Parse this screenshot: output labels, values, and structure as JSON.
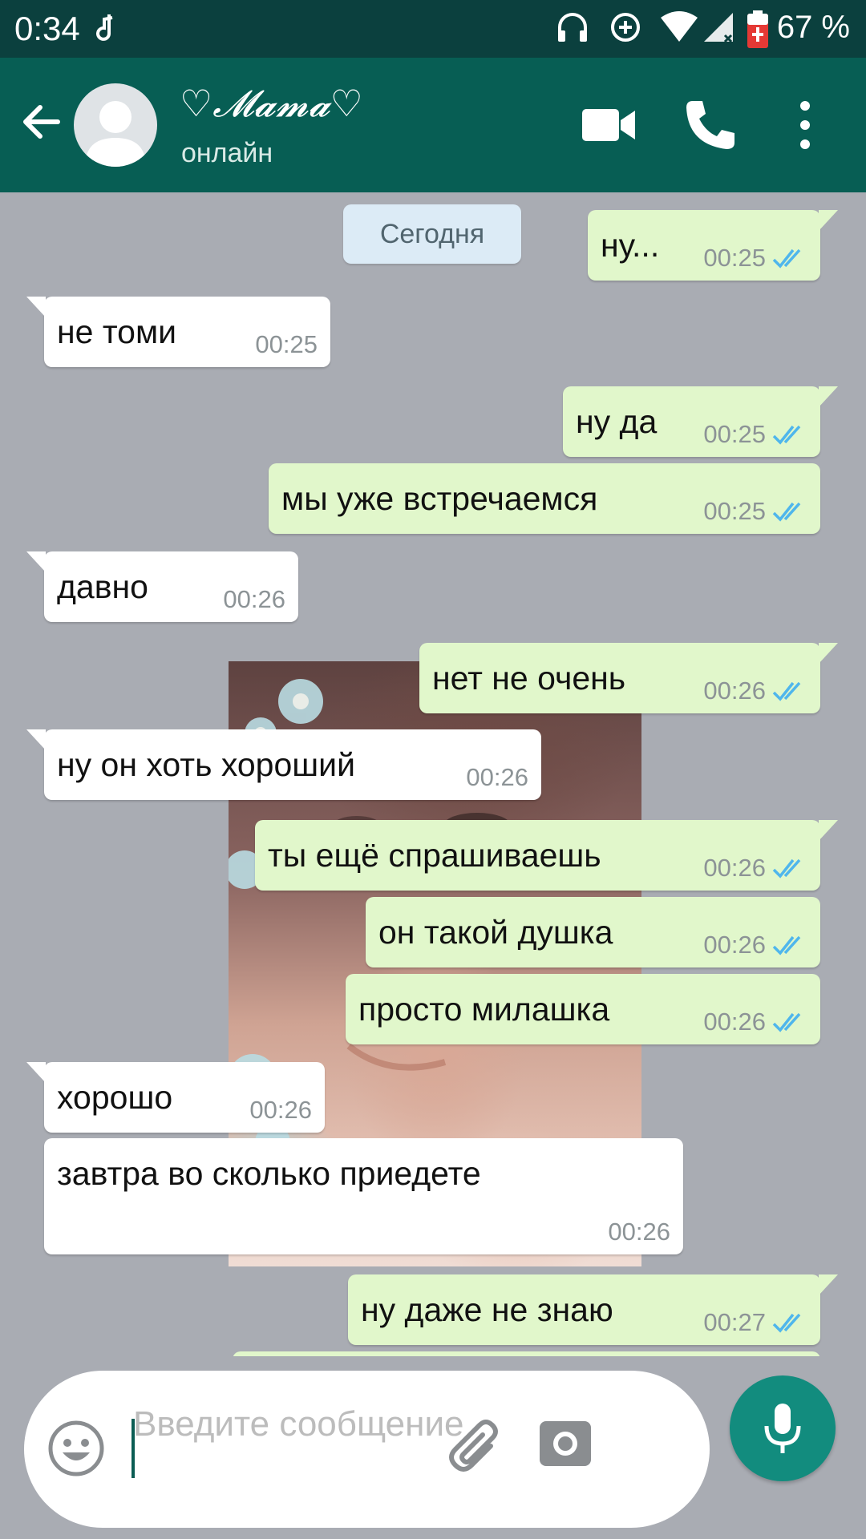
{
  "status_bar": {
    "time": "0:34",
    "battery_percent": "67 %",
    "icons": [
      "music-note-icon",
      "headphones-icon",
      "data-saver-icon",
      "wifi-icon",
      "signal-icon",
      "battery-icon"
    ]
  },
  "header": {
    "contact_name": "♡𝓜𝓪𝓶𝓪♡",
    "contact_status": "онлайн",
    "icons": [
      "back-arrow-icon",
      "avatar-placeholder-icon",
      "video-call-icon",
      "phone-call-icon",
      "more-vert-icon"
    ]
  },
  "chat": {
    "date_chip": "Сегодня",
    "messages": [
      {
        "dir": "out",
        "text": "ну...",
        "time": "00:25",
        "read": true
      },
      {
        "dir": "in",
        "text": "не томи",
        "time": "00:25"
      },
      {
        "dir": "out",
        "text": "ну да",
        "time": "00:25",
        "read": true
      },
      {
        "dir": "out",
        "text": "мы уже встречаемся",
        "time": "00:25",
        "read": true
      },
      {
        "dir": "in",
        "text": "давно",
        "time": "00:26"
      },
      {
        "dir": "out",
        "text": "нет не очень",
        "time": "00:26",
        "read": true
      },
      {
        "dir": "in",
        "text": "ну он хоть хороший",
        "time": "00:26"
      },
      {
        "dir": "out",
        "text": "ты ещё спрашиваешь",
        "time": "00:26",
        "read": true
      },
      {
        "dir": "out",
        "text": "он такой душка",
        "time": "00:26",
        "read": true
      },
      {
        "dir": "out",
        "text": "просто милашка",
        "time": "00:26",
        "read": true
      },
      {
        "dir": "in",
        "text": "хорошо",
        "time": "00:26"
      },
      {
        "dir": "in",
        "text": "завтра во сколько приедете",
        "time": "00:26"
      },
      {
        "dir": "out",
        "text": "ну даже не знаю",
        "time": "00:27",
        "read": true
      }
    ]
  },
  "composer": {
    "placeholder": "Введите сообщение",
    "icons": [
      "emoji-icon",
      "paperclip-icon",
      "camera-icon",
      "microphone-icon"
    ]
  },
  "colors": {
    "status_bar": "#0b403e",
    "app_bar": "#075e54",
    "chat_background": "#a9acb3",
    "outgoing_bubble": "#e1f7cb",
    "incoming_bubble": "#ffffff",
    "read_ticks": "#4fb6ec",
    "mic_button": "#128c7e"
  }
}
